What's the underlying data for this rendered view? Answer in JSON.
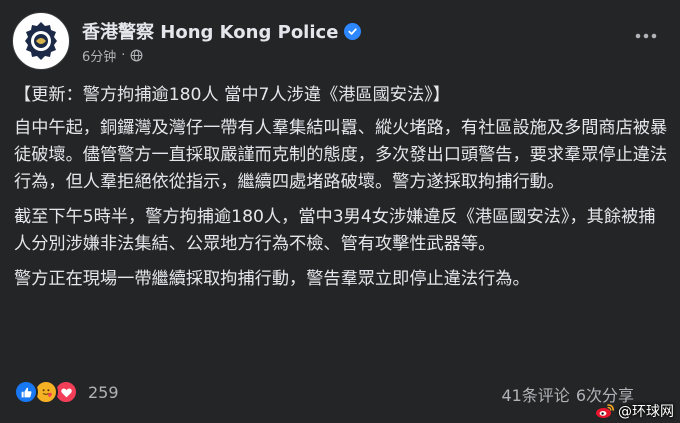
{
  "post": {
    "page_name": "香港警察 Hong Kong Police",
    "timestamp": "6分钟",
    "paragraphs": [
      "【更新：警方拘捕逾180人 當中7人涉違《港區國安法》】",
      "自中午起，銅鑼灣及灣仔一帶有人羣集結叫囂、縱火堵路，有社區設施及多間商店被暴徒破壞。儘管警方一直採取嚴謹而克制的態度，多次發出口頭警告，要求羣眾停止違法行為，但人羣拒絕依從指示，繼續四處堵路破壞。警方遂採取拘捕行動。",
      "截至下午5時半，警方拘捕逾180人，當中3男4女涉嫌違反《港區國安法》，其餘被捕人分別涉嫌非法集結、公眾地方行為不檢、管有攻擊性武器等。",
      "警方正在現場一帶繼續採取拘捕行動，警告羣眾立即停止違法行為。"
    ]
  },
  "footer": {
    "reaction_count": "259",
    "comments": "41条评论",
    "shares": "6次分享"
  },
  "watermark": {
    "text": "@环球网"
  },
  "icons": {
    "avatar": "police-badge-icon",
    "verified": "verified-badge-icon",
    "audience": "globe-icon",
    "more": "more-options-icon",
    "reactions": [
      "like-icon",
      "care-icon",
      "love-icon"
    ]
  },
  "colors": {
    "card_bg": "#242526",
    "text": "#e4e6eb",
    "secondary_text": "#b0b3b8",
    "verified": "#2d88ff",
    "like": "#1877f2",
    "care": "#f7b125",
    "love": "#f33e58"
  }
}
